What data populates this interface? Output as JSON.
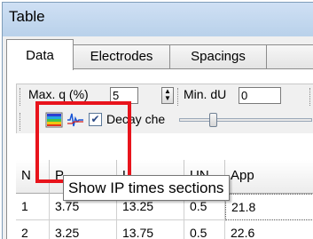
{
  "window": {
    "title": "Table"
  },
  "tabs": [
    {
      "label": "Data"
    },
    {
      "label": "Electrodes"
    },
    {
      "label": "Spacings"
    }
  ],
  "toolbar": {
    "max_label": "Max. q (%)",
    "max_value": "5",
    "min_label": "Min. dU",
    "min_value": "0",
    "decay_checkbox_label": "Decay che",
    "decay_checked": true,
    "slider_level": 0.25
  },
  "grid": {
    "headers": [
      "N",
      "P",
      "U",
      "UN",
      "App"
    ],
    "rows": [
      [
        "1",
        "3.75",
        "13.25",
        "0.5",
        "21.8"
      ],
      [
        "2",
        "3.25",
        "13.75",
        "0.5",
        "22.6"
      ]
    ]
  },
  "tooltip": {
    "text": "Show IP times sections"
  },
  "colors": {
    "highlight": "#e8141c"
  }
}
